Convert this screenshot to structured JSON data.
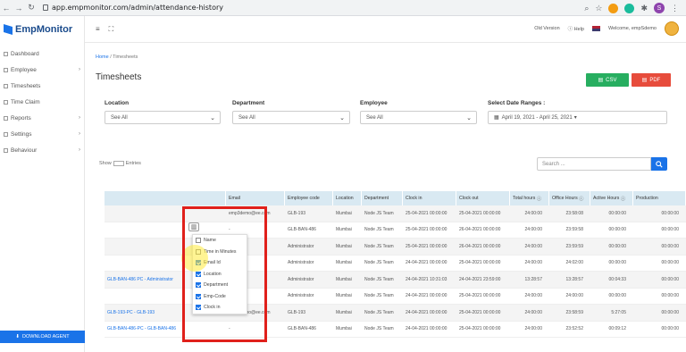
{
  "browser": {
    "url": "app.empmonitor.com/admin/attendance-history",
    "profile_initial": "S"
  },
  "logo": {
    "text": "EmpMonitor"
  },
  "sidebar": {
    "items": [
      {
        "label": "Dashboard",
        "caret": ""
      },
      {
        "label": "Employee",
        "caret": "›"
      },
      {
        "label": "Timesheets",
        "caret": ""
      },
      {
        "label": "Time Claim",
        "caret": ""
      },
      {
        "label": "Reports",
        "caret": "›"
      },
      {
        "label": "Settings",
        "caret": "›"
      },
      {
        "label": "Behaviour",
        "caret": "›"
      }
    ],
    "download_label": "DOWNLOAD AGENT"
  },
  "topbar": {
    "old_version": "Old Version",
    "help": "Help",
    "welcome": "Welcome, empSdemo"
  },
  "breadcrumb": {
    "home": "Home",
    "sep": "/",
    "current": "Timesheets"
  },
  "page": {
    "title": "Timesheets"
  },
  "export": {
    "csv_label": "CSV",
    "pdf_label": "PDF"
  },
  "filters": {
    "location": {
      "label": "Location",
      "value": "See All"
    },
    "department": {
      "label": "Department",
      "value": "See All"
    },
    "employee": {
      "label": "Employee",
      "value": "See All"
    },
    "date": {
      "label": "Select Date Ranges :",
      "value": "April 19, 2021 - April 25, 2021"
    }
  },
  "search": {
    "placeholder": "Search ..."
  },
  "show_entries": {
    "prefix": "Show",
    "suffix": "Entries"
  },
  "table": {
    "headers": [
      "",
      "Email",
      "Employee code",
      "Location",
      "Department",
      "Clock in",
      "Clock out",
      "Total hours",
      "Office Hours",
      "Active Hours",
      "Production"
    ],
    "rows": [
      [
        "",
        "emp3demo@ee.com",
        "GLB-193",
        "Mumbai",
        "Node JS Team",
        "25-04-2021 00:00:00",
        "25-04-2021 00:00:00",
        "24:00:00",
        "23:58:08",
        "00:00:00",
        "00:00:00"
      ],
      [
        "",
        "-",
        "GLB-BAN-486",
        "Mumbai",
        "Node JS Team",
        "25-04-2021 00:00:00",
        "26-04-2021 00:00:00",
        "24:00:00",
        "23:59:58",
        "00:00:00",
        "00:00:00"
      ],
      [
        "",
        "-",
        "Administrator",
        "Mumbai",
        "Node JS Team",
        "25-04-2021 00:00:00",
        "26-04-2021 00:00:00",
        "24:00:00",
        "23:59:59",
        "00:00:00",
        "00:00:00"
      ],
      [
        "",
        "-",
        "Administrator",
        "Mumbai",
        "Node JS Team",
        "24-04-2021 00:00:00",
        "25-04-2021 00:00:00",
        "24:00:00",
        "24:02:00",
        "00:00:00",
        "00:00:00"
      ],
      [
        "GLB-BAN-486 PC - Administrator",
        "-",
        "Administrator",
        "Mumbai",
        "Node JS Team",
        "24-04-2021 10:31:03",
        "24-04-2021 23:59:00",
        "13:28:57",
        "13:28:57",
        "00:04:33",
        "00:00:00"
      ],
      [
        "",
        "-",
        "Administrator",
        "Mumbai",
        "Node JS Team",
        "24-04-2021 00:00:00",
        "25-04-2021 00:00:00",
        "24:00:00",
        "24:00:00",
        "00:00:00",
        "00:00:00"
      ],
      [
        "GLB-193-PC - GLB-193",
        "emp3demo@ee.com",
        "GLB-193",
        "Mumbai",
        "Node JS Team",
        "24-04-2021 00:00:00",
        "25-04-2021 00:00:00",
        "24:00:00",
        "23:58:59",
        "5:27:05",
        "00:00:00"
      ],
      [
        "GLB-BAN-486-PC - GLB-BAN-486",
        "-",
        "GLB-BAN-486",
        "Mumbai",
        "Node JS Team",
        "24-04-2021 00:00:00",
        "25-04-2021 00:00:00",
        "24:00:00",
        "23:52:52",
        "00:09:12",
        "00:00:00"
      ]
    ]
  },
  "column_picker": {
    "items": [
      {
        "label": "Name",
        "checked": false
      },
      {
        "label": "Time in Minutes",
        "checked": false
      },
      {
        "label": "Email Id",
        "checked": true
      },
      {
        "label": "Location",
        "checked": true
      },
      {
        "label": "Department",
        "checked": true
      },
      {
        "label": "Emp-Code",
        "checked": true
      },
      {
        "label": "Clock in",
        "checked": true
      }
    ]
  }
}
